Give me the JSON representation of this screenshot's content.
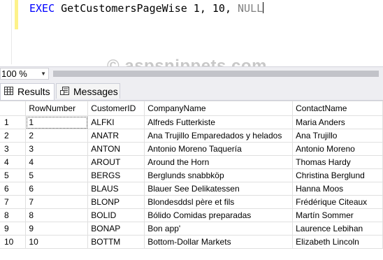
{
  "editor": {
    "keyword": "EXEC",
    "procedure": "GetCustomersPageWise 1, 10, ",
    "null_kw": "NULL"
  },
  "watermark": "© aspsnippets.com",
  "zoom": {
    "value": "100 %"
  },
  "tabs": [
    {
      "label": "Results",
      "icon": "grid-icon"
    },
    {
      "label": "Messages",
      "icon": "messages-icon"
    }
  ],
  "grid": {
    "columns": [
      "RowNumber",
      "CustomerID",
      "CompanyName",
      "ContactName"
    ],
    "rows": [
      {
        "n": "1",
        "rownumber": "1",
        "customerid": "ALFKI",
        "company": "Alfreds Futterkiste",
        "contact": "Maria Anders"
      },
      {
        "n": "2",
        "rownumber": "2",
        "customerid": "ANATR",
        "company": "Ana Trujillo Emparedados y helados",
        "contact": "Ana Trujillo"
      },
      {
        "n": "3",
        "rownumber": "3",
        "customerid": "ANTON",
        "company": "Antonio Moreno Taquería",
        "contact": "Antonio Moreno"
      },
      {
        "n": "4",
        "rownumber": "4",
        "customerid": "AROUT",
        "company": "Around the Horn",
        "contact": "Thomas Hardy"
      },
      {
        "n": "5",
        "rownumber": "5",
        "customerid": "BERGS",
        "company": "Berglunds snabbköp",
        "contact": "Christina Berglund"
      },
      {
        "n": "6",
        "rownumber": "6",
        "customerid": "BLAUS",
        "company": "Blauer See Delikatessen",
        "contact": "Hanna Moos"
      },
      {
        "n": "7",
        "rownumber": "7",
        "customerid": "BLONP",
        "company": "Blondesddsl père et fils",
        "contact": "Frédérique Citeaux"
      },
      {
        "n": "8",
        "rownumber": "8",
        "customerid": "BOLID",
        "company": "Bólido Comidas preparadas",
        "contact": "Martín Sommer"
      },
      {
        "n": "9",
        "rownumber": "9",
        "customerid": "BONAP",
        "company": "Bon app'",
        "contact": "Laurence Lebihan"
      },
      {
        "n": "10",
        "rownumber": "10",
        "customerid": "BOTTM",
        "company": "Bottom-Dollar Markets",
        "contact": "Elizabeth Lincoln"
      }
    ]
  }
}
